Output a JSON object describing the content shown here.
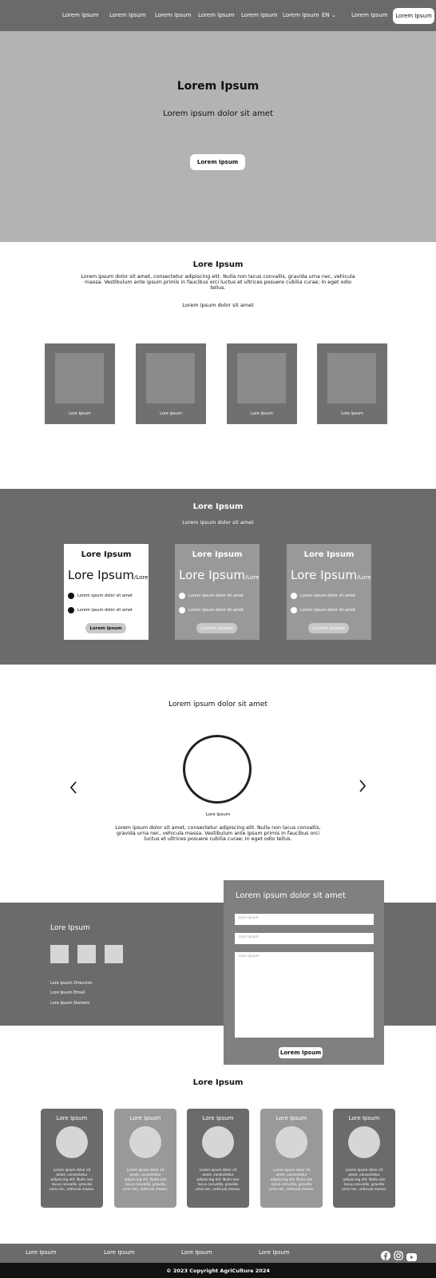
{
  "nav": {
    "links": [
      "Lorem Ipsum",
      "Lorem Ipsum",
      "Lorem Ipsum",
      "Lorem Ipsum",
      "Lorem Ipsum",
      "Lorem Ipsum"
    ],
    "lang": "EN",
    "login": "Lorem Ipsum",
    "cta": "Lorem Ipsum"
  },
  "hero": {
    "title": "Lorem Ipsum",
    "subtitle": "Lorem ipsum dolor sit amet",
    "button": "Lorem Ipsum"
  },
  "about": {
    "title": "Lore Ipsum",
    "text": "Lorem ipsum dolor sit amet, consectetur adipiscing elit. Nulla non lacus convallis, gravida urna nec, vehicula massa. Vestibulum ante ipsum primis in faucibus orci luctus et ultrices posuere cubilia curae; In eget odio tellus.",
    "subtext": "Lorem ipsum dolor sit amet",
    "cards": [
      "Lore Ipsum",
      "Lore Ipsum",
      "Lore Ipsum",
      "Lore Ipsum"
    ]
  },
  "pricing": {
    "title": "Lore Ipsum",
    "subtitle": "Lorem ipsum dolor sit amet",
    "plans": [
      {
        "title": "Lore Ipsum",
        "price": "Lore Ipsum",
        "unit": "/Lore",
        "features": [
          "Lorem ipsum dolor sit amet",
          "Lorem ipsum dolor sit amet"
        ],
        "button": "Lorem Ipsum"
      },
      {
        "title": "Lore Ipsum",
        "price": "Lore Ipsum",
        "unit": "/Lore",
        "features": [
          "Lorem ipsum dolor sit amet",
          "Lorem ipsum dolor sit amet"
        ],
        "button": "Lorem Ipsum"
      },
      {
        "title": "Lore Ipsum",
        "price": "Lore Ipsum",
        "unit": "/Lore",
        "features": [
          "Lorem ipsum dolor sit amet",
          "Lorem ipsum dolor sit amet"
        ],
        "button": "Lorem Ipsum"
      }
    ]
  },
  "testimonial": {
    "title": "Lorem ipsum dolor sit amet",
    "name": "Lore Ipsum",
    "text": "Lorem ipsum dolor sit amet, consectetur adipiscing elit. Nulla non lacus convallis, gravida urna nec, vehicula massa. Vestibulum ante ipsum primis in faucibus orci luctus et ultrices posuere cubilia curae; In eget odio tellus."
  },
  "contact": {
    "title": "Lore Ipsum",
    "address": "Lore Ipsum Direccion",
    "email": "Lore Ipsum Email",
    "phone": "Lore Ipsum Numero",
    "form_title": "Lorem ipsum dolor sit amet",
    "name_placeholder": "Lore Ipsum",
    "email_placeholder": "Lore Ipsum",
    "message_placeholder": "Lore Ipsum",
    "submit": "Lorem Ipsum"
  },
  "team": {
    "title": "Lore Ipsum",
    "members": [
      {
        "name": "Lore Ipsum",
        "desc": "Lorem ipsum dolor sit amet, consectetur adipiscing elit. Nulla non lacus convallis, gravida urna nec, vehicula massa."
      },
      {
        "name": "Lore Ipsum",
        "desc": "Lorem ipsum dolor sit amet, consectetur adipiscing elit. Nulla non lacus convallis, gravida urna nec, vehicula massa."
      },
      {
        "name": "Lore Ipsum",
        "desc": "Lorem ipsum dolor sit amet, consectetur adipiscing elit. Nulla non lacus convallis, gravida urna nec, vehicula massa."
      },
      {
        "name": "Lore Ipsum",
        "desc": "Lorem ipsum dolor sit amet, consectetur adipiscing elit. Nulla non lacus convallis, gravida urna nec, vehicula massa."
      },
      {
        "name": "Lore Ipsum",
        "desc": "Lorem ipsum dolor sit amet, consectetur adipiscing elit. Nulla non lacus convallis, gravida urna nec, vehicula massa."
      }
    ]
  },
  "footer": {
    "links": [
      "Lore Ipsum",
      "Lore Ipsum",
      "Lore Ipsum",
      "Lore Ipsum"
    ],
    "copyright": "© 2023 Copyright AgriCulture 2024",
    "icons": [
      "facebook-icon",
      "instagram-icon",
      "youtube-icon"
    ]
  }
}
